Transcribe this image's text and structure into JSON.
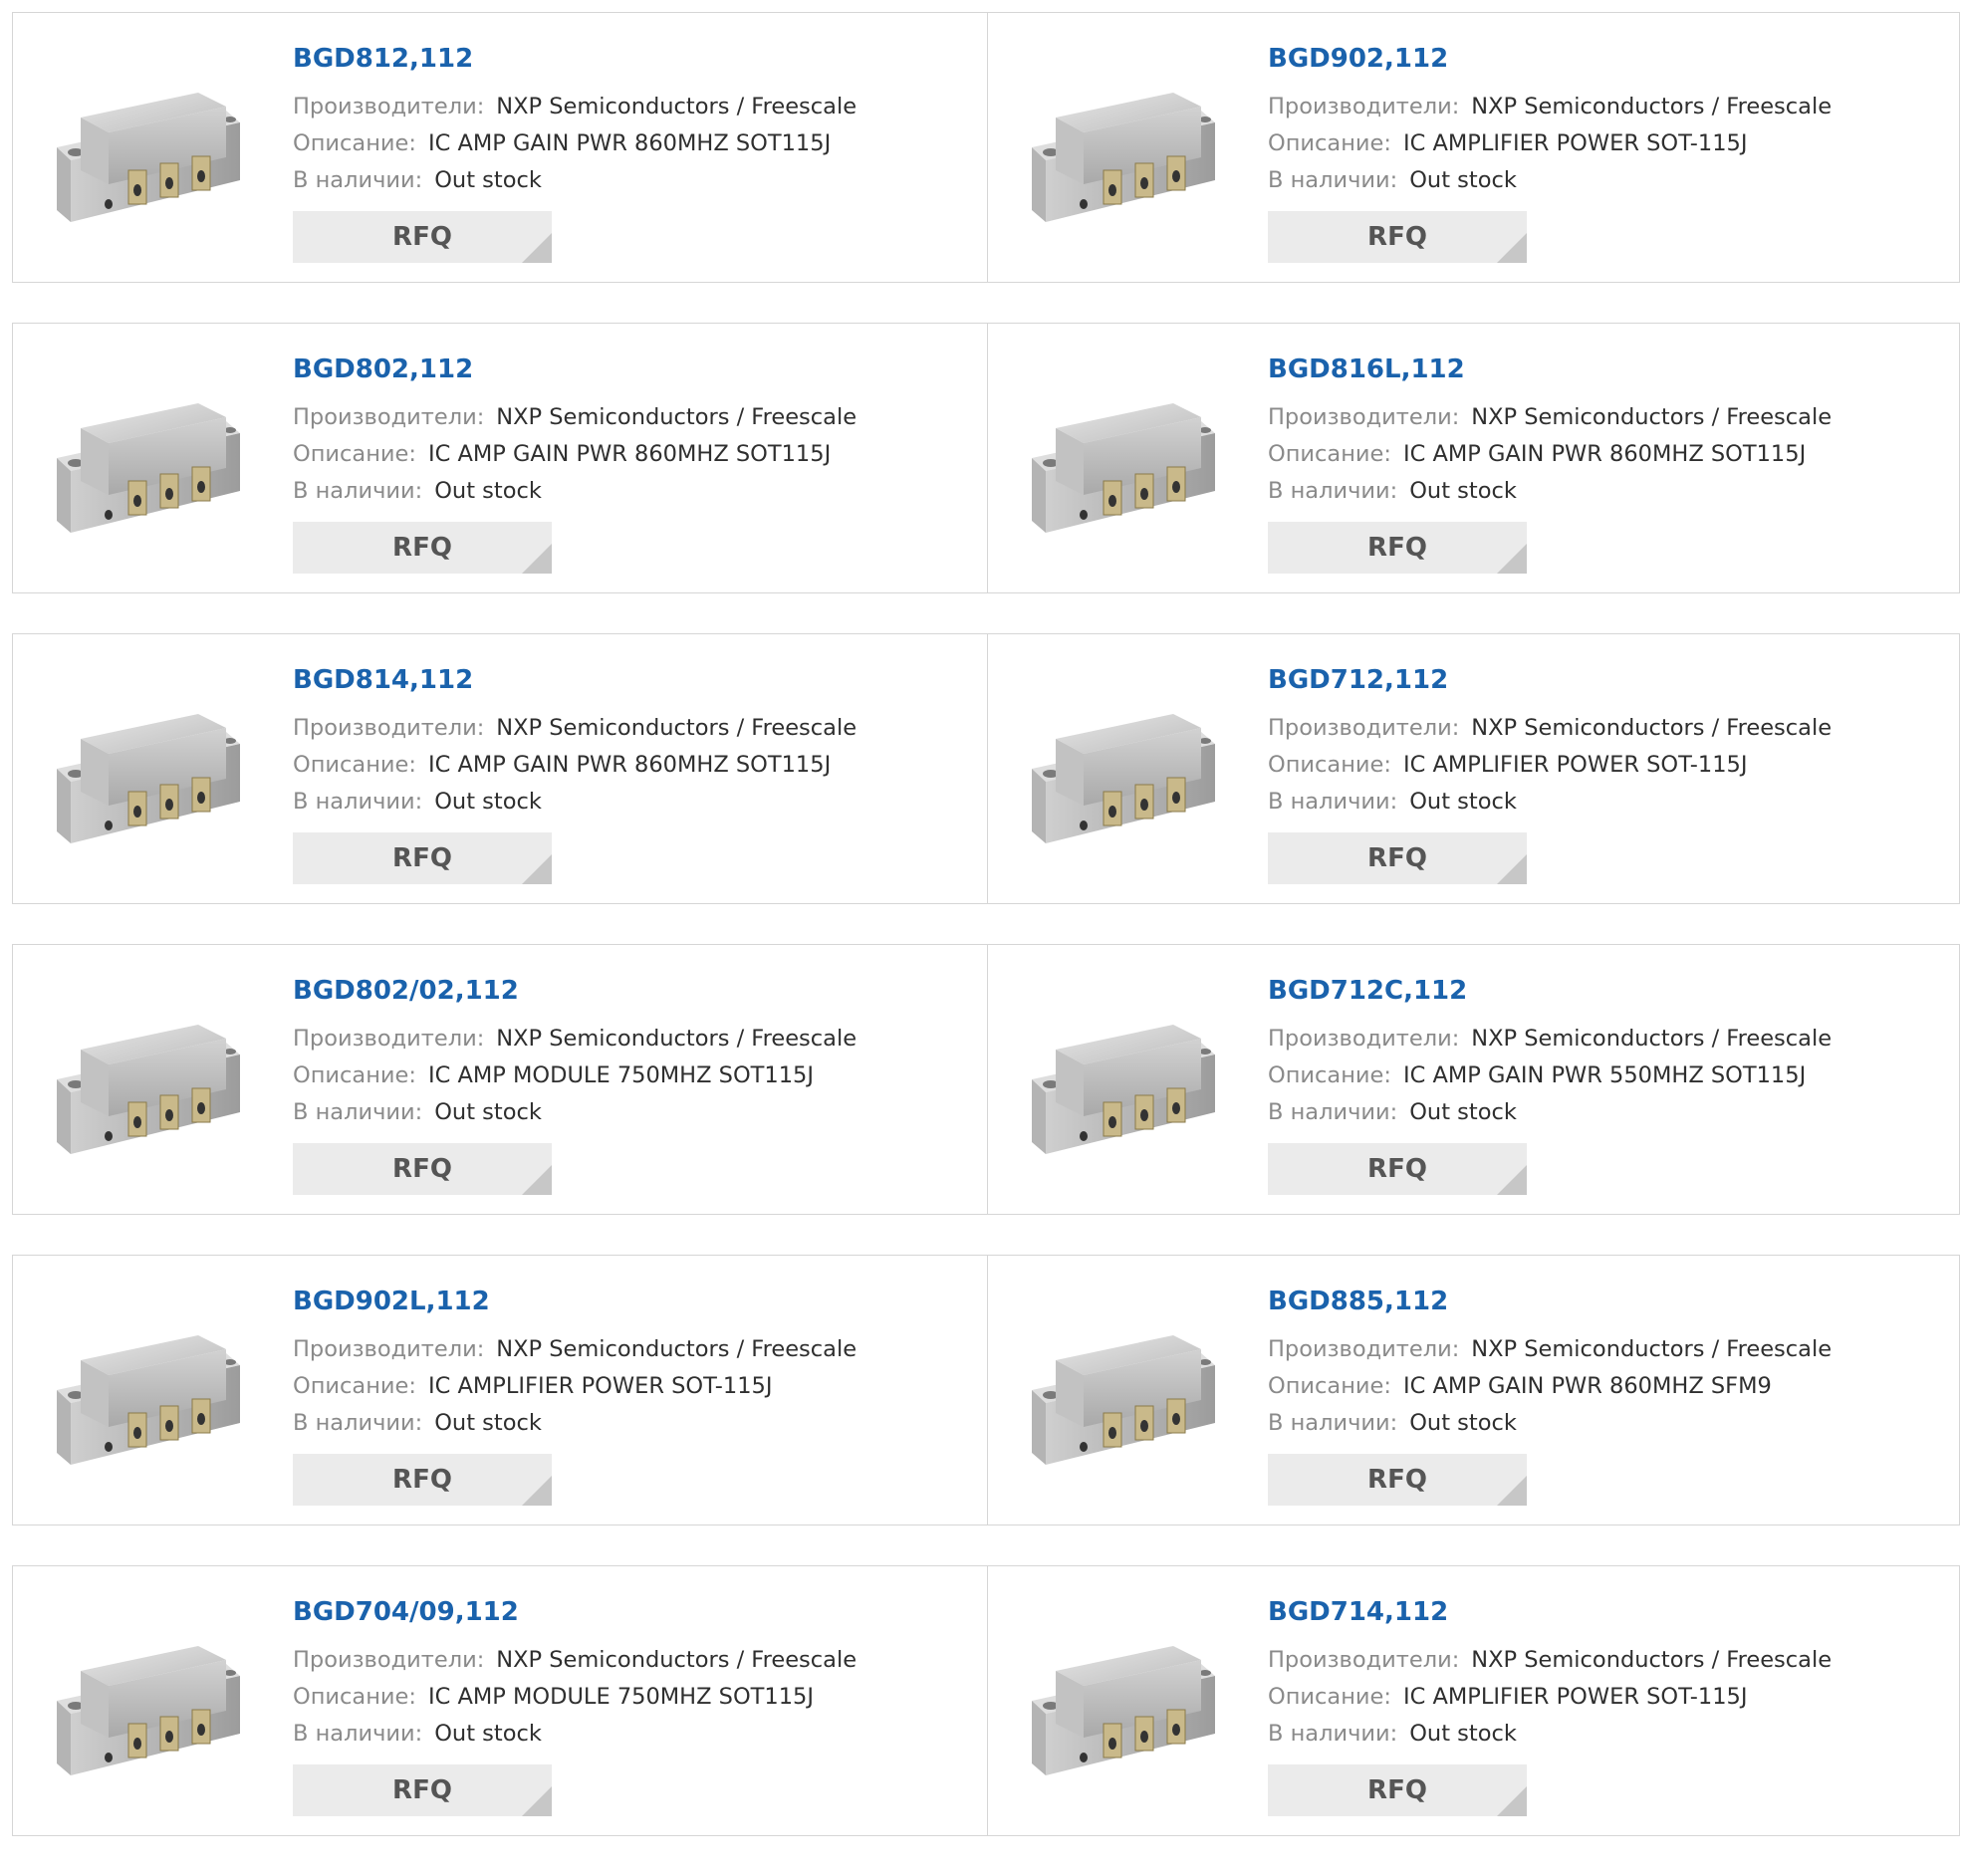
{
  "labels": {
    "manufacturer": "Производители:",
    "description": "Описание:",
    "stock": "В наличии:",
    "rfq": "RFQ"
  },
  "colors": {
    "part_number": "#1a62ac",
    "rfq_bg": "#ebebeb",
    "border": "#d6d6d6"
  },
  "icons": {
    "product_image": "rf-amplifier-module-icon",
    "rfq_corner": "corner-triangle-icon"
  },
  "products": [
    {
      "part": "BGD812,112",
      "manufacturer": "NXP Semiconductors / Freescale",
      "description": "IC AMP GAIN PWR 860MHZ SOT115J",
      "stock": "Out stock"
    },
    {
      "part": "BGD902,112",
      "manufacturer": "NXP Semiconductors / Freescale",
      "description": "IC AMPLIFIER POWER SOT-115J",
      "stock": "Out stock"
    },
    {
      "part": "BGD802,112",
      "manufacturer": "NXP Semiconductors / Freescale",
      "description": "IC AMP GAIN PWR 860MHZ SOT115J",
      "stock": "Out stock"
    },
    {
      "part": "BGD816L,112",
      "manufacturer": "NXP Semiconductors / Freescale",
      "description": "IC AMP GAIN PWR 860MHZ SOT115J",
      "stock": "Out stock"
    },
    {
      "part": "BGD814,112",
      "manufacturer": "NXP Semiconductors / Freescale",
      "description": "IC AMP GAIN PWR 860MHZ SOT115J",
      "stock": "Out stock"
    },
    {
      "part": "BGD712,112",
      "manufacturer": "NXP Semiconductors / Freescale",
      "description": "IC AMPLIFIER POWER SOT-115J",
      "stock": "Out stock"
    },
    {
      "part": "BGD802/02,112",
      "manufacturer": "NXP Semiconductors / Freescale",
      "description": "IC AMP MODULE 750MHZ SOT115J",
      "stock": "Out stock"
    },
    {
      "part": "BGD712C,112",
      "manufacturer": "NXP Semiconductors / Freescale",
      "description": "IC AMP GAIN PWR 550MHZ SOT115J",
      "stock": "Out stock"
    },
    {
      "part": "BGD902L,112",
      "manufacturer": "NXP Semiconductors / Freescale",
      "description": "IC AMPLIFIER POWER SOT-115J",
      "stock": "Out stock"
    },
    {
      "part": "BGD885,112",
      "manufacturer": "NXP Semiconductors / Freescale",
      "description": "IC AMP GAIN PWR 860MHZ SFM9",
      "stock": "Out stock"
    },
    {
      "part": "BGD704/09,112",
      "manufacturer": "NXP Semiconductors / Freescale",
      "description": "IC AMP MODULE 750MHZ SOT115J",
      "stock": "Out stock"
    },
    {
      "part": "BGD714,112",
      "manufacturer": "NXP Semiconductors / Freescale",
      "description": "IC AMPLIFIER POWER SOT-115J",
      "stock": "Out stock"
    }
  ]
}
